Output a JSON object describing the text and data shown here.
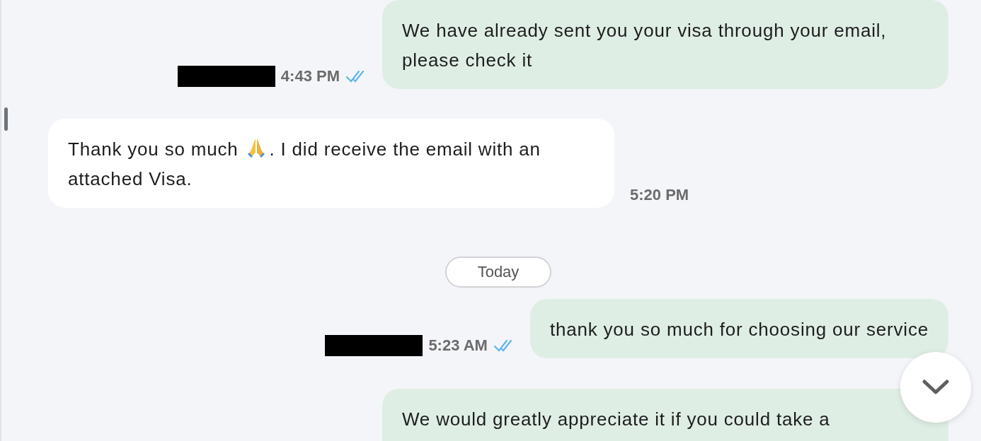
{
  "messages": [
    {
      "kind": "outgoing",
      "segments": [
        {
          "kind": "text",
          "text": "We have already sent you your visa through your email, please check it"
        }
      ],
      "sender_redacted": true,
      "time": "4:43 PM",
      "read": true
    },
    {
      "kind": "incoming",
      "segments": [
        {
          "kind": "text",
          "text": "Thank you so much"
        },
        {
          "kind": "emoji"
        },
        {
          "kind": "text",
          "text": ". I did receive the email with an"
        },
        {
          "kind": "text",
          "text": "attached Visa."
        }
      ],
      "time": "5:20 PM"
    },
    {
      "kind": "date",
      "label": "Today"
    },
    {
      "kind": "outgoing",
      "segments": [
        {
          "kind": "text",
          "text": "thank you so much for choosing our service"
        }
      ],
      "sender_redacted": true,
      "time": "5:23 AM",
      "read": true
    },
    {
      "kind": "outgoing",
      "segments": [
        {
          "kind": "text",
          "text": "We would greatly appreciate it if you could take a"
        }
      ]
    }
  ],
  "scroll_to_bottom": true
}
